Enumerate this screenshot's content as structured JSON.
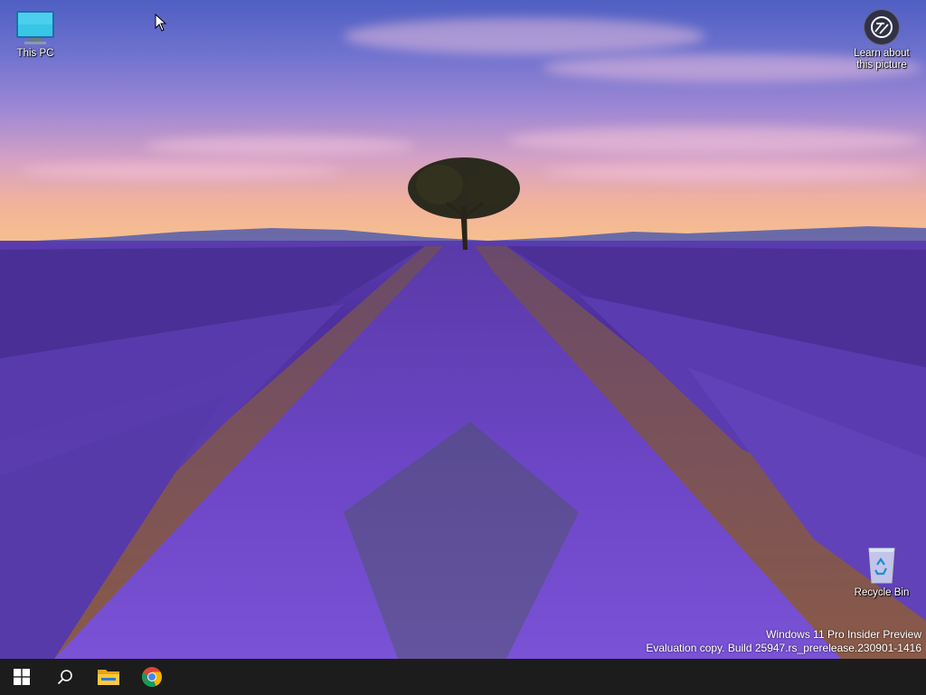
{
  "desktop": {
    "icons": {
      "this_pc": "This PC",
      "learn_line1": "Learn about",
      "learn_line2": "this picture",
      "recycle_bin": "Recycle Bin"
    },
    "watermark": {
      "line1": "Windows 11 Pro Insider Preview",
      "line2": "Evaluation copy. Build 25947.rs_prerelease.230901-1416"
    }
  },
  "taskbar": {
    "items": [
      "start-icon",
      "search-icon",
      "file-explorer-icon",
      "chrome-icon"
    ]
  },
  "colors": {
    "taskbar": "#1c1c1c",
    "lavender": "#6a48b8",
    "windows_blue": "#0078d4"
  }
}
